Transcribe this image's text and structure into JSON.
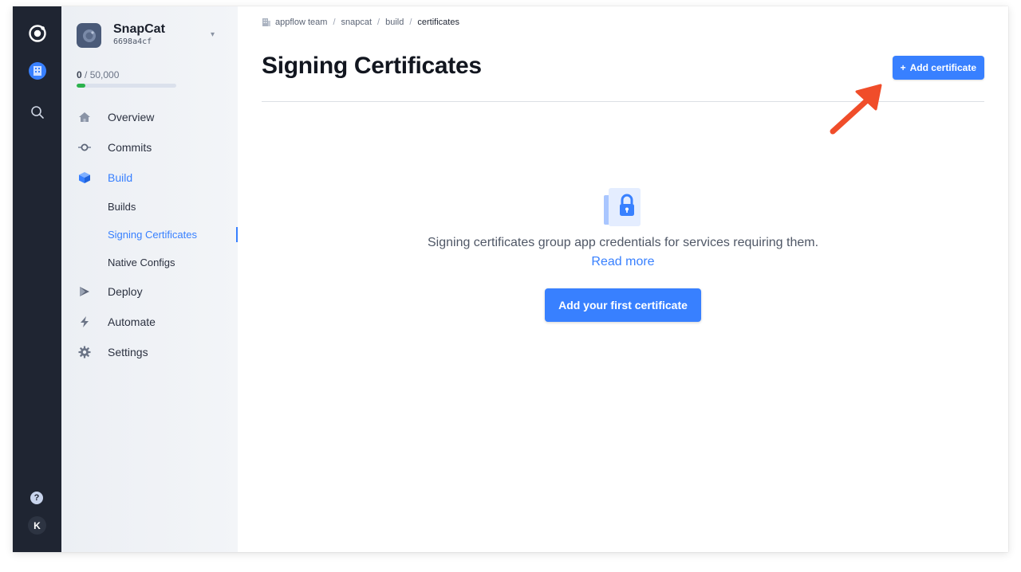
{
  "colors": {
    "accent": "#3880ff",
    "rail": "#1f2532",
    "annotation": "#f04d2a",
    "usage": "#2bb24c"
  },
  "rail": {
    "items": [
      {
        "name": "ionic-logo-icon"
      },
      {
        "name": "org-building-icon"
      },
      {
        "name": "search-icon"
      }
    ],
    "help_label": "?",
    "avatar_initial": "K"
  },
  "project": {
    "name": "SnapCat",
    "id": "6698a4cf",
    "caret_icon": "chevron-down-icon"
  },
  "usage": {
    "used": "0",
    "limit": "/ 50,000",
    "fraction": 0.0
  },
  "nav": {
    "overview": "Overview",
    "commits": "Commits",
    "build": "Build",
    "builds": "Builds",
    "signing_certificates": "Signing Certificates",
    "native_configs": "Native Configs",
    "deploy": "Deploy",
    "automate": "Automate",
    "settings": "Settings"
  },
  "breadcrumb": {
    "team": "appflow team",
    "app": "snapcat",
    "section": "build",
    "current": "certificates",
    "separator": "/"
  },
  "page": {
    "title": "Signing Certificates",
    "add_button": "Add certificate",
    "add_button_icon": "+"
  },
  "empty_state": {
    "icon": "lock-certificate-icon",
    "description": "Signing certificates group app credentials for services requiring them.",
    "read_more": "Read more",
    "cta": "Add your first certificate"
  }
}
